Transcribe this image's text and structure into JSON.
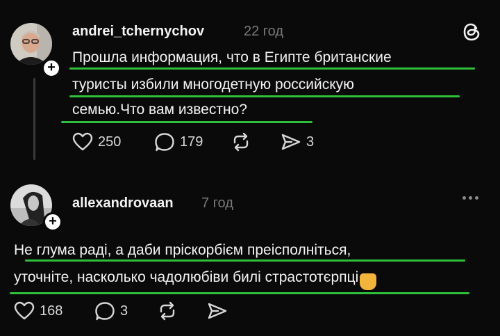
{
  "post1": {
    "username": "andrei_tchernychov",
    "time": "22 год",
    "lines": [
      "Прошла информация, что в Египте британские",
      "туристы избили многодетную российскую",
      "семью.Что вам известно?"
    ],
    "likes": "250",
    "comments": "179",
    "shares": "3"
  },
  "post2": {
    "username": "allexandrovaan",
    "time": "7 год",
    "lines": [
      "Не глума раді, а даби пріскорбієм преісполніться,",
      "уточніте, насколько чадолюбіви билі страстотєрпці"
    ],
    "emoji": "🙏",
    "likes": "168",
    "comments": "3"
  },
  "icons": {
    "add": "+",
    "heart": "heart-icon",
    "comment": "comment-icon",
    "repost": "repost-icon",
    "share": "share-icon",
    "threads": "threads-logo-icon",
    "more": "more-icon"
  },
  "colors": {
    "background": "#0a0a0a",
    "text": "#f3f3f3",
    "muted": "#7a7a7a",
    "underline": "#2fbf3a"
  }
}
